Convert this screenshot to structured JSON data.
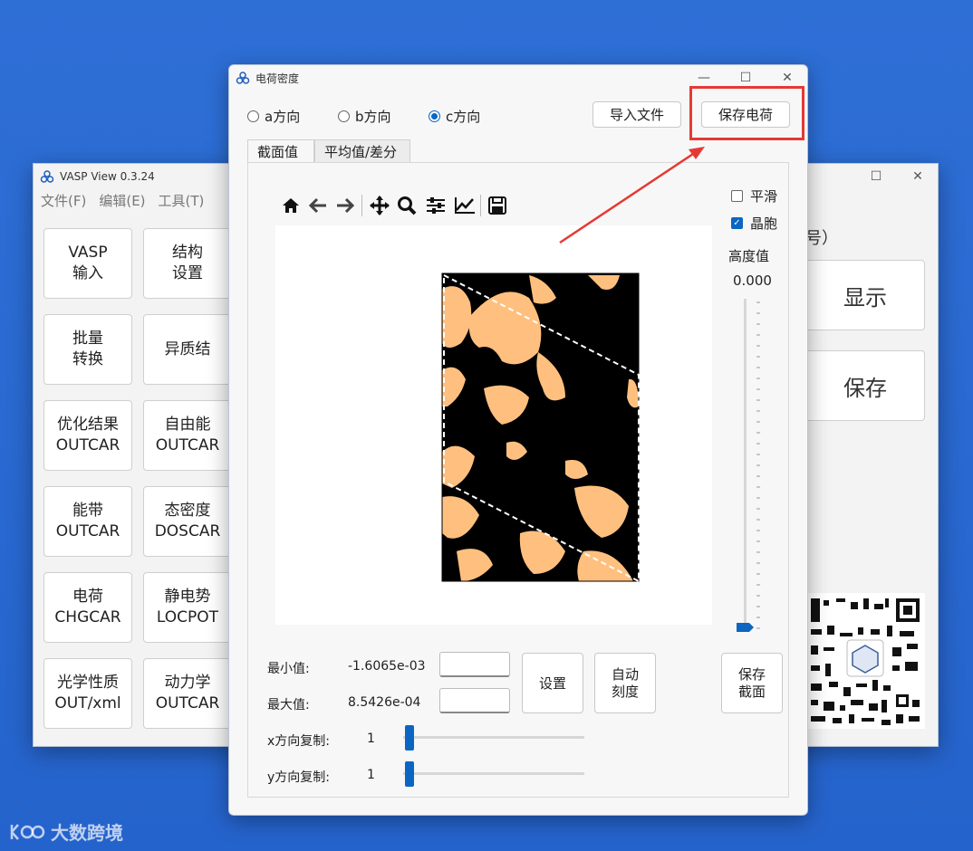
{
  "vasp_window": {
    "title": "VASP View 0.3.24",
    "menu": [
      "文件(F)",
      "编辑(E)",
      "工具(T)"
    ],
    "buttons": [
      "VASP\n输入",
      "结构\n设置",
      "批量\n转换",
      "异质结",
      "优化结果\nOUTCAR",
      "自由能\nOUTCAR",
      "能带\nOUTCAR",
      "态密度\nDOSCAR",
      "电荷\nCHGCAR",
      "静电势\nLOCPOT",
      "光学性质\nOUT/xml",
      "动力学\nOUTCAR"
    ]
  },
  "right_window": {
    "partial_label": "号）",
    "show_button": "显示",
    "save_button": "保存"
  },
  "charge_window": {
    "title": "电荷密度",
    "directions": [
      "a方向",
      "b方向",
      "c方向"
    ],
    "selected_direction": "c方向",
    "import_button": "导入文件",
    "save_charge_button": "保存电荷",
    "tabs": [
      "截面值",
      "平均值/差分"
    ],
    "active_tab": "截面值",
    "toolbar_icons": [
      "home-icon",
      "back-arrow-icon",
      "forward-arrow-icon",
      "pan-icon",
      "zoom-icon",
      "configure-icon",
      "edit-axis-icon",
      "save-icon"
    ],
    "smooth_label": "平滑",
    "smooth_checked": false,
    "cell_label": "晶胞",
    "cell_checked": true,
    "height_label": "高度值",
    "height_value": "0.000",
    "min_label": "最小值:",
    "min_value": "-1.6065e-03",
    "max_label": "最大值:",
    "max_value": "8.5426e-04",
    "set_button": "设置",
    "auto_scale_button": "自动\n刻度",
    "save_section_button": "保存\n截面",
    "x_repeat_label": "x方向复制:",
    "x_repeat_value": "1",
    "y_repeat_label": "y方向复制:",
    "y_repeat_value": "1"
  },
  "watermark": "大数跨境",
  "colors": {
    "desktop": "#2563cc",
    "accent": "#0a66c2",
    "highlight": "#e53935",
    "density_high": "#ffc07f",
    "density_low": "#000000"
  }
}
